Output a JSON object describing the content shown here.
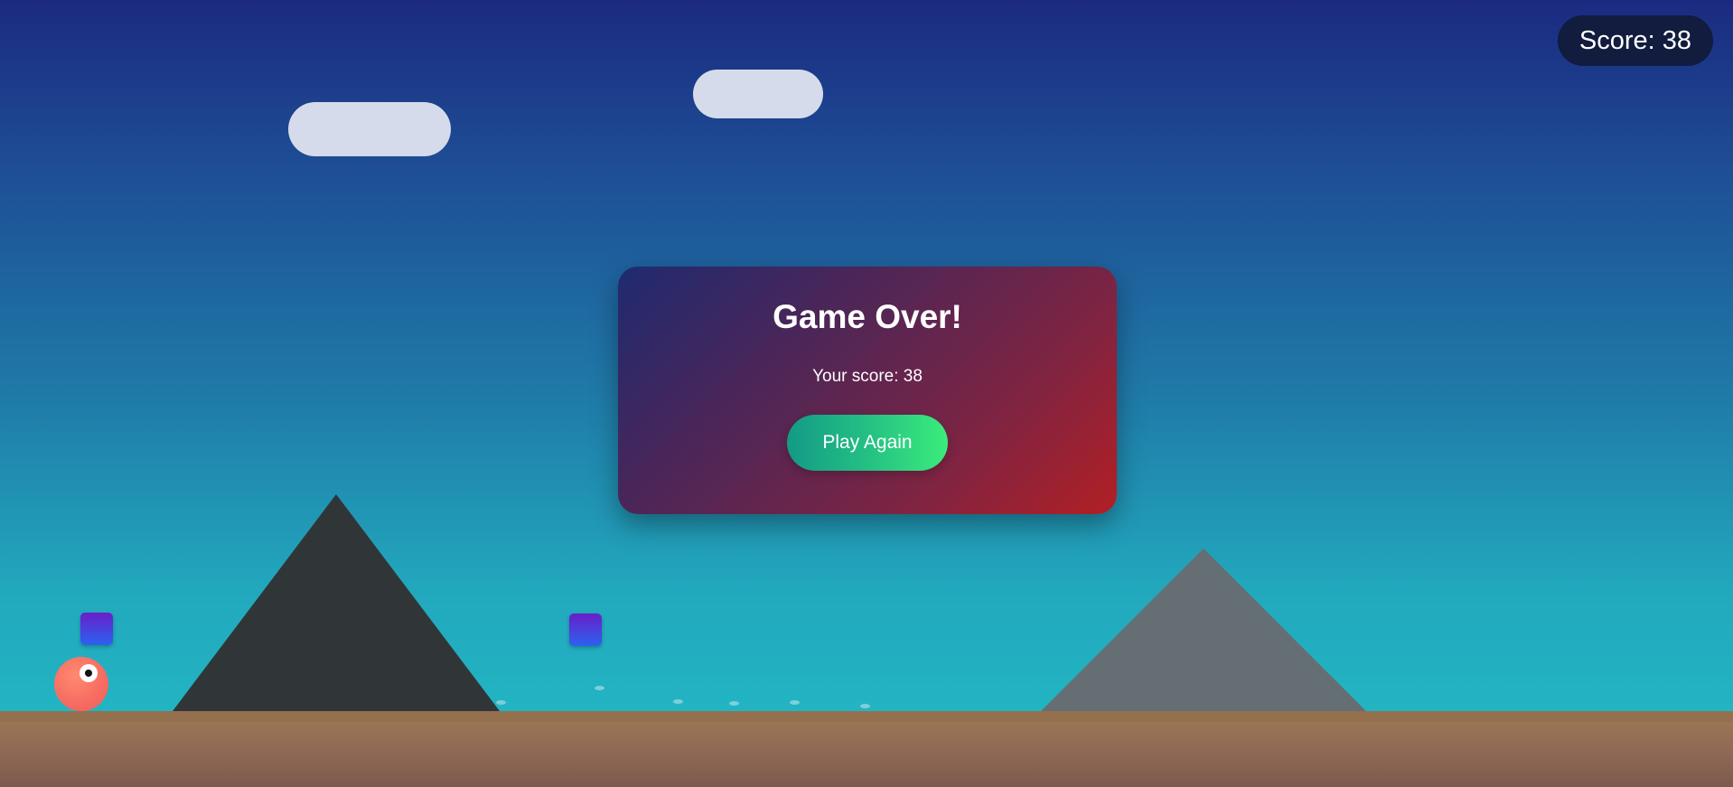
{
  "hud": {
    "score_label": "Score: 38"
  },
  "game_over": {
    "title": "Game Over!",
    "score_text": "Your score: 38",
    "play_again_label": "Play Again"
  },
  "state": {
    "score": 38,
    "status": "game_over"
  },
  "colors": {
    "sky_top": "#1b2a80",
    "sky_bottom": "#23bcc6",
    "player": "#f76b62",
    "obstacle_top": "#6a1ec9",
    "obstacle_bottom": "#2a63f0",
    "ground": "#9a7354",
    "button": "#26c483",
    "hud_background": "#111c3e"
  }
}
